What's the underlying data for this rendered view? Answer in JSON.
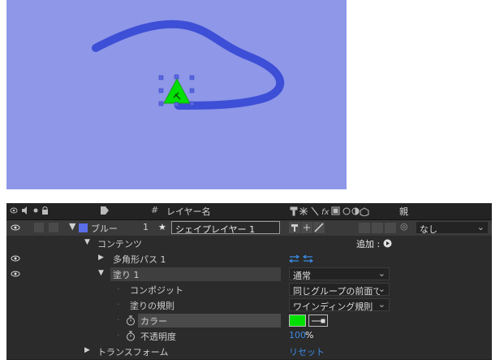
{
  "header": {
    "hash_symbol": "#",
    "layer_name_label": "レイヤー名",
    "parent_label": "親"
  },
  "layer": {
    "label_color_name": "ブルー",
    "index": "1",
    "name": "シェイプレイヤー 1",
    "parent_value": "なし"
  },
  "rows": {
    "contents_label": "コンテンツ",
    "add_label": "追加 :",
    "polygon_path_label": "多角形パス 1",
    "fill_label": "塗り 1",
    "fill_blend_mode": "通常",
    "composite_label": "コンポジット",
    "composite_value": "同じグループの前面で",
    "fill_rule_label": "塗りの規則",
    "fill_rule_value": "ワインディング規則",
    "color_label": "カラー",
    "opacity_label": "不透明度",
    "opacity_value": "100",
    "opacity_unit": "%",
    "transform_label": "トランスフォーム",
    "reset_label": "リセット"
  },
  "colors": {
    "viewer_bg": "#8e97e8",
    "stroke": "#3d4fd6",
    "fill_green": "#00e000",
    "label_blue": "#5a6ee8"
  }
}
